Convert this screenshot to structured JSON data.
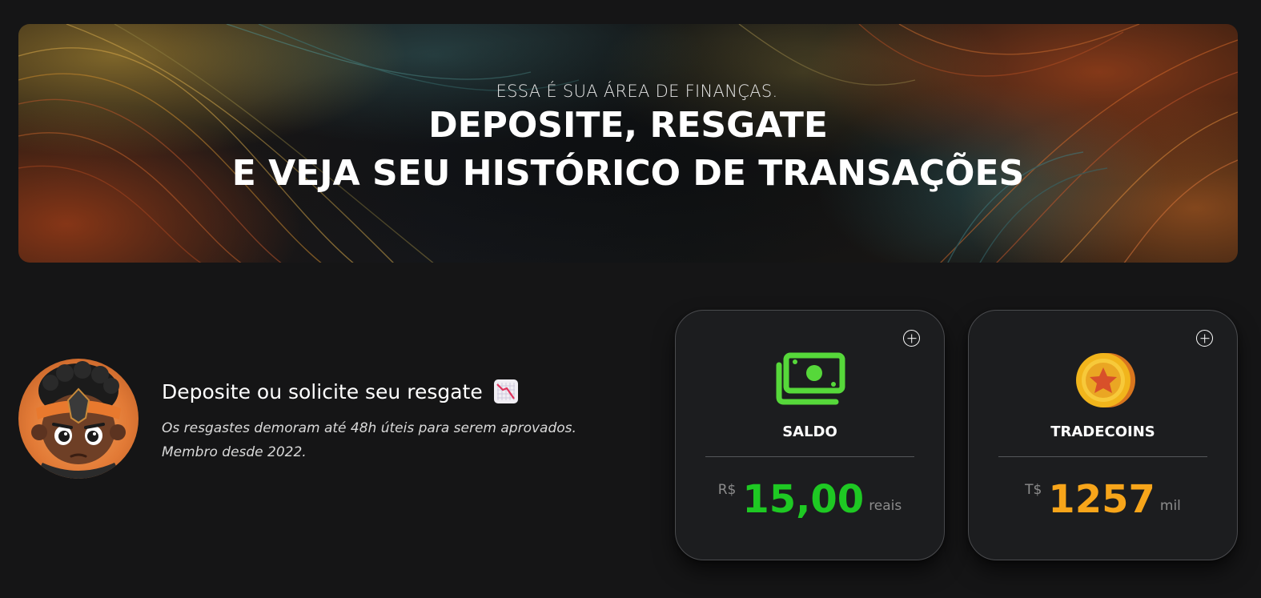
{
  "hero": {
    "subtitle": "ESSA É SUA ÁREA DE FINANÇAS.",
    "title_line1": "DEPOSITE, RESGATE",
    "title_line2": "E VEJA SEU HISTÓRICO DE TRANSAÇÕES"
  },
  "profile": {
    "heading": "Deposite ou solicite seu resgate",
    "heading_emoji": "chart-decreasing-icon",
    "description_line1": "Os resgastes demoram até 48h úteis para serem aprovados.",
    "description_line2": "Membro desde 2022."
  },
  "cards": {
    "saldo": {
      "label": "SALDO",
      "currency": "R$",
      "amount": "15,00",
      "unit": "reais",
      "icon": "money-icon",
      "accent": "#1ec923"
    },
    "tradecoins": {
      "label": "TRADECOINS",
      "currency": "T$",
      "amount": "1257",
      "unit": "mil",
      "icon": "coin-icon",
      "accent": "#f7a51a"
    }
  }
}
